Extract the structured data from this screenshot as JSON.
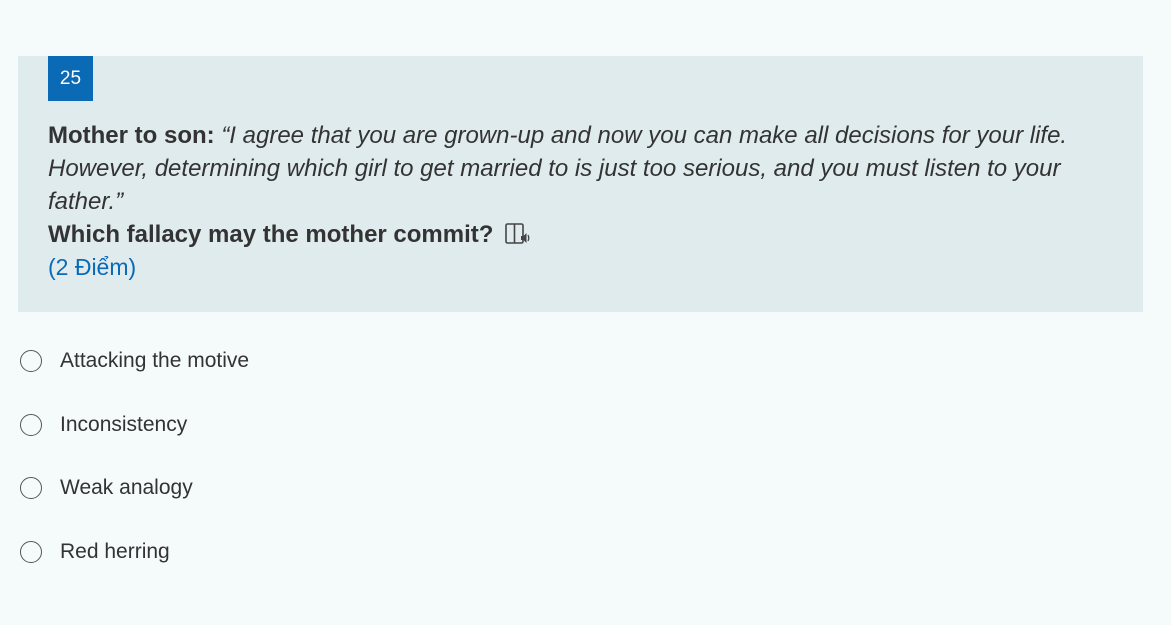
{
  "question": {
    "number": "25",
    "speaker_label": "Mother to son:",
    "quote": "“I agree that you are grown-up and now you can make all decisions for your life. However, determining which girl to get married to is just too serious, and you must listen to your father.”",
    "prompt": "Which fallacy may the mother commit?",
    "points": "(2 Điểm)",
    "tts_icon": "immersive-reader-icon"
  },
  "options": [
    {
      "label": "Attacking the motive",
      "selected": false
    },
    {
      "label": "Inconsistency",
      "selected": false
    },
    {
      "label": "Weak analogy",
      "selected": false
    },
    {
      "label": "Red herring",
      "selected": false
    }
  ],
  "colors": {
    "page_background": "#f5fbfb",
    "card_background": "#e0ebee",
    "accent": "#0a6ab5",
    "text": "#333333"
  }
}
